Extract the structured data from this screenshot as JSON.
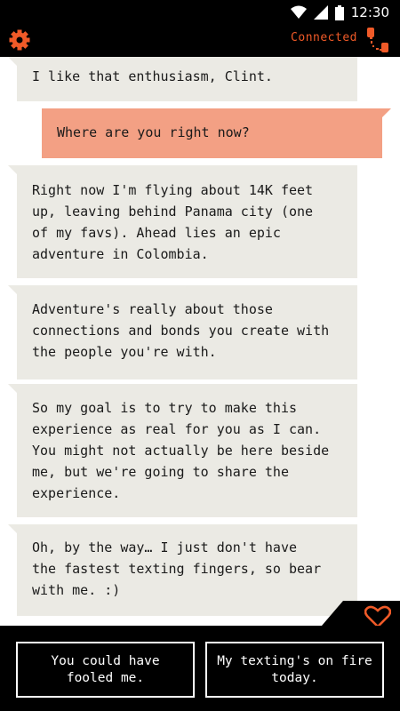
{
  "status_bar": {
    "time": "12:30",
    "icons": [
      "wifi-icon",
      "cellular-signal-icon",
      "battery-icon"
    ]
  },
  "header": {
    "settings_icon": "gear-icon",
    "status_label": "Connected",
    "status_icon": "phone-icon",
    "accent_color": "#f05a28"
  },
  "messages": [
    {
      "sender": "them",
      "text": "I like that enthusiasm, Clint."
    },
    {
      "sender": "me",
      "text": "Where are you right now?"
    },
    {
      "sender": "them",
      "text": "Right now I'm flying about 14K feet\nup, leaving behind Panama city (one\nof my favs). Ahead lies an epic\nadventure in Colombia."
    },
    {
      "sender": "them",
      "text": "Adventure's really about those\nconnections and bonds you create with\nthe people you're with."
    },
    {
      "sender": "them",
      "text": "So my goal is to try to make this\nexperience as real for you as I can.\nYou might not actually be here beside\nme, but we're going to share the\nexperience."
    },
    {
      "sender": "them",
      "text": "Oh, by the way… I just don't have\nthe fastest texting fingers, so bear\nwith me. :)"
    }
  ],
  "colors": {
    "incoming_bubble": "#ebeae4",
    "outgoing_bubble": "#f3a084",
    "background": "#ffffff",
    "bar": "#000000"
  },
  "reply_options": [
    {
      "label": "You could have\nfooled me."
    },
    {
      "label": "My texting's on fire\ntoday."
    }
  ],
  "favorite_icon": "heart-icon"
}
